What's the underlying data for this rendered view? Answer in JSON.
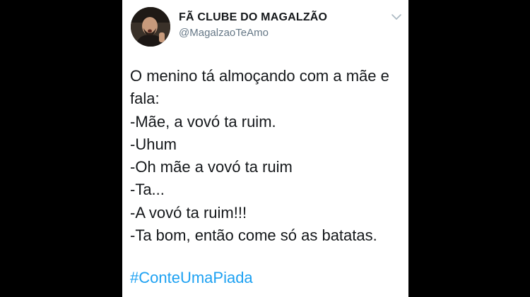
{
  "tweet": {
    "author": {
      "display_name": "FÃ CLUBE DO MAGALZÃO",
      "handle": "@MagalzaoTeAmo",
      "avatar_icon": "profile-photo"
    },
    "menu_icon": "chevron-down-icon",
    "lines": [
      "O menino tá almoçando com a mãe e",
      "fala:",
      "-Mãe, a vovó ta ruim.",
      "-Uhum",
      "-Oh mãe a vovó ta ruim",
      "-Ta...",
      "-A vovó ta ruim!!!",
      "-Ta bom, então come só as batatas."
    ],
    "hashtag": "#ConteUmaPiada"
  },
  "colors": {
    "background": "#000000",
    "card": "#ffffff",
    "text": "#14171a",
    "secondary_text": "#657786",
    "link": "#1da1f2"
  }
}
